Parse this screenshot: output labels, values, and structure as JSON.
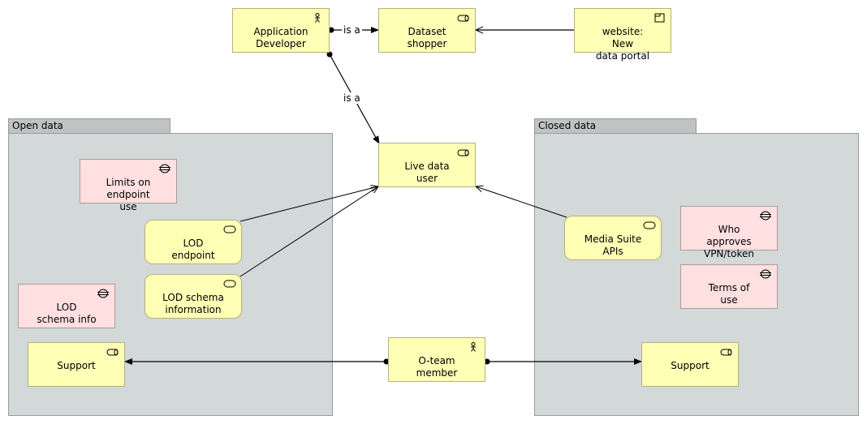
{
  "diagram": {
    "groups": {
      "open_data": {
        "label": "Open data"
      },
      "closed_data": {
        "label": "Closed data"
      }
    },
    "nodes": {
      "app_dev": {
        "label": "Application\nDeveloper",
        "type": "actor"
      },
      "dataset_shopper": {
        "label": "Dataset\nshopper",
        "type": "role"
      },
      "website": {
        "label": "website: New\ndata portal",
        "type": "application-interface"
      },
      "live_data_user": {
        "label": "Live data\nuser",
        "type": "role"
      },
      "limits": {
        "label": "Limits on\nendpoint\nuse",
        "type": "constraint"
      },
      "lod_endpoint": {
        "label": "LOD\nendpoint",
        "type": "service"
      },
      "lod_schema_info_service": {
        "label": "LOD schema\ninformation",
        "type": "service"
      },
      "lod_schema_info": {
        "label": "LOD\nschema info",
        "type": "constraint"
      },
      "support_open": {
        "label": "Support",
        "type": "role"
      },
      "media_suite": {
        "label": "Media Suite\nAPIs",
        "type": "service"
      },
      "who_approves": {
        "label": "Who\napproves\nVPN/token",
        "type": "constraint"
      },
      "terms": {
        "label": "Terms of\nuse",
        "type": "constraint"
      },
      "oteam": {
        "label": "O-team\nmember",
        "type": "actor"
      },
      "support_closed": {
        "label": "Support",
        "type": "role"
      }
    },
    "edge_labels": {
      "dev_to_shopper": "is a",
      "dev_to_live": "is a"
    }
  }
}
